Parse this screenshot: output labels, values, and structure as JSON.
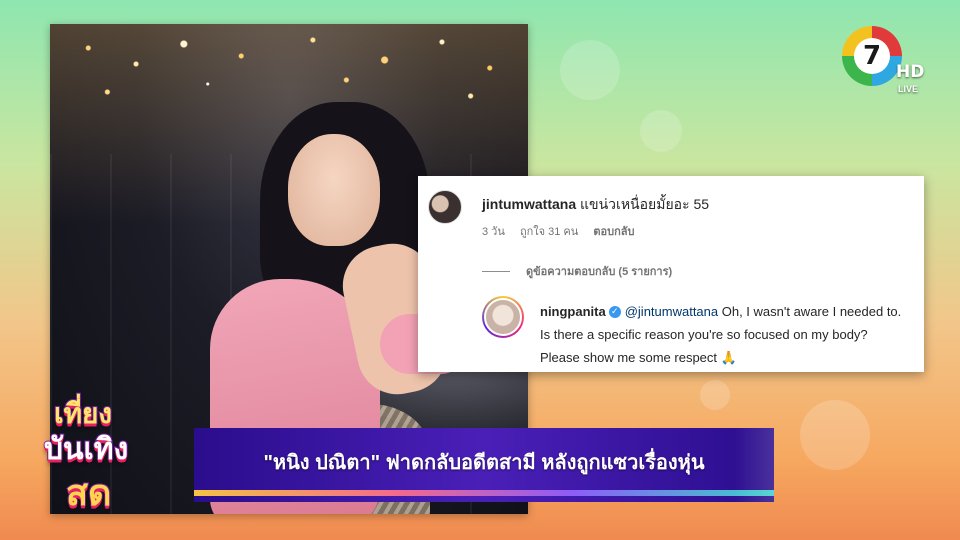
{
  "channel": {
    "logo_number": "7",
    "hd_label": "HD",
    "live_label": "LIVE"
  },
  "photo": {
    "icon": "person-photo"
  },
  "comment": {
    "username": "jintumwattana",
    "text": "แขน่วเหนื่อยมั้ยอะ 55",
    "time": "3 วัน",
    "likes": "ถูกใจ 31 คน",
    "reply_label": "ตอบกลับ",
    "view_replies": "ดูข้อความตอบกลับ (5 รายการ)"
  },
  "reply": {
    "username": "ningpanita",
    "mention": "@jintumwattana",
    "text": " Oh, I wasn't aware I needed to. Is there a specific reason you're so focused on my body? Please show me some respect",
    "emoji": "🙏"
  },
  "show": {
    "line1": "เที่ยง",
    "line2": "บันเทิง",
    "line3": "สด"
  },
  "headline": "\"หนิง ปณิตา\" ฟาดกลับอดีตสามี หลังถูกแซวเรื่องหุ่น"
}
